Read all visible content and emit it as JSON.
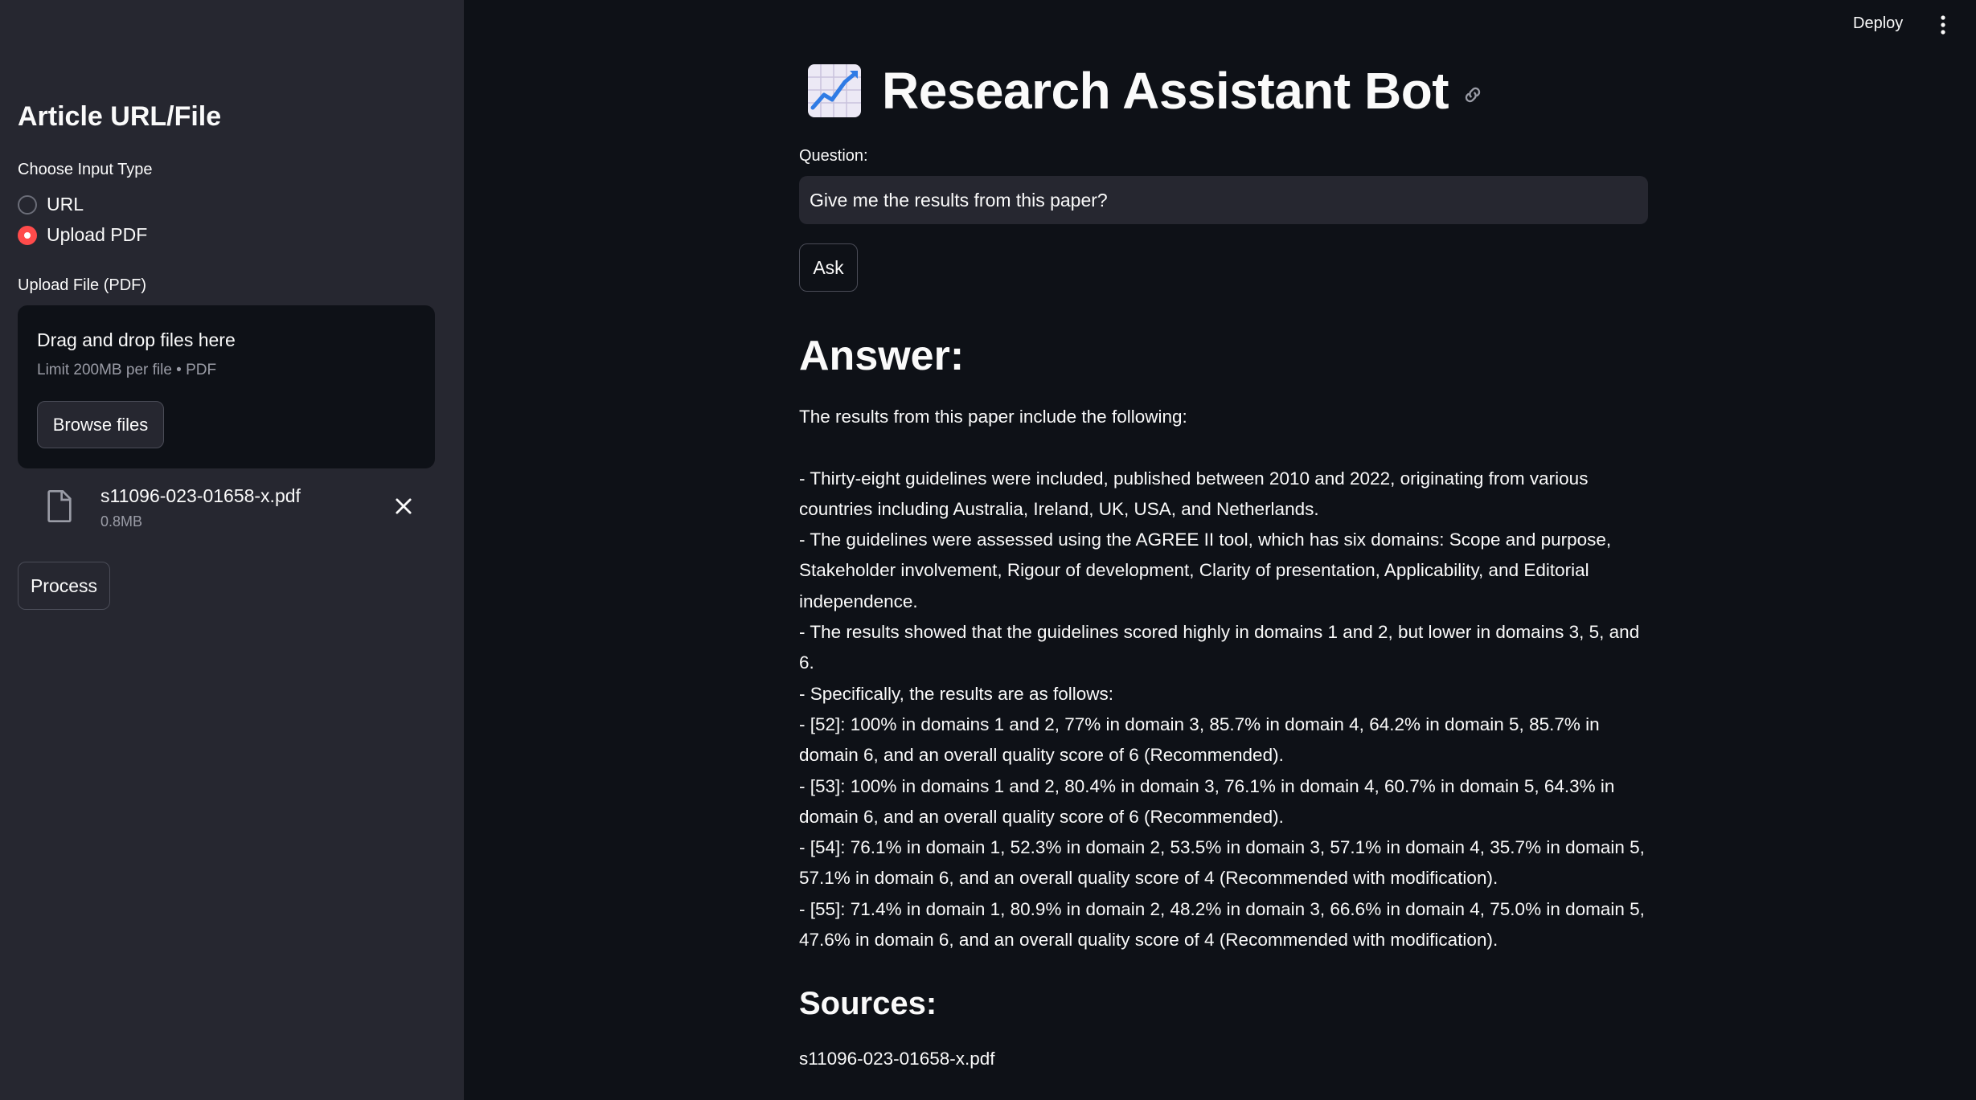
{
  "header": {
    "deploy_label": "Deploy"
  },
  "sidebar": {
    "title": "Article URL/File",
    "input_type_label": "Choose Input Type",
    "options": [
      {
        "label": "URL",
        "selected": false
      },
      {
        "label": "Upload PDF",
        "selected": true
      }
    ],
    "upload_label": "Upload File (PDF)",
    "dropzone": {
      "title": "Drag and drop files here",
      "limit": "Limit 200MB per file • PDF",
      "browse_label": "Browse files"
    },
    "file": {
      "name": "s11096-023-01658-x.pdf",
      "size": "0.8MB"
    },
    "process_label": "Process"
  },
  "main": {
    "title": "Research Assistant Bot",
    "question_label": "Question:",
    "question_value": "Give me the results from this paper?",
    "ask_label": "Ask",
    "answer_heading": "Answer:",
    "answer_intro": "The results from this paper include the following:",
    "answer_points": [
      "- Thirty-eight guidelines were included, published between 2010 and 2022, originating from various countries including Australia, Ireland, UK, USA, and Netherlands.",
      "- The guidelines were assessed using the AGREE II tool, which has six domains: Scope and purpose, Stakeholder involvement, Rigour of development, Clarity of presentation, Applicability, and Editorial independence.",
      "- The results showed that the guidelines scored highly in domains 1 and 2, but lower in domains 3, 5, and 6.",
      "- Specifically, the results are as follows:",
      "- [52]: 100% in domains 1 and 2, 77% in domain 3, 85.7% in domain 4, 64.2% in domain 5, 85.7% in domain 6, and an overall quality score of 6 (Recommended).",
      "- [53]: 100% in domains 1 and 2, 80.4% in domain 3, 76.1% in domain 4, 60.7% in domain 5, 64.3% in domain 6, and an overall quality score of 6 (Recommended).",
      "- [54]: 76.1% in domain 1, 52.3% in domain 2, 53.5% in domain 3, 57.1% in domain 4, 35.7% in domain 5, 57.1% in domain 6, and an overall quality score of 4 (Recommended with modification).",
      "- [55]: 71.4% in domain 1, 80.9% in domain 2, 48.2% in domain 3, 66.6% in domain 4, 75.0% in domain 5, 47.6% in domain 6, and an overall quality score of 4 (Recommended with modification)."
    ],
    "sources_heading": "Sources:",
    "sources": [
      "s11096-023-01658-x.pdf"
    ]
  },
  "colors": {
    "background": "#0e1117",
    "sidebar": "#262730",
    "accent": "#ff4b4b",
    "text": "#fafafa",
    "muted": "#9a9ca6"
  }
}
